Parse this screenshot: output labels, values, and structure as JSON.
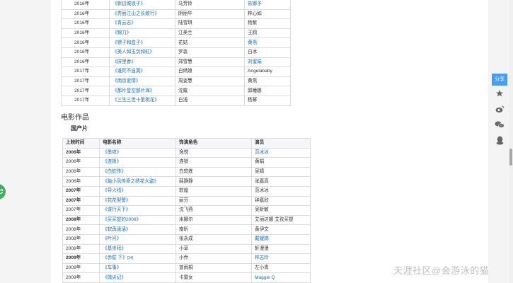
{
  "tv_rows": [
    {
      "year": "2016年",
      "title": "《新边城浪子》",
      "role": "马芳铃",
      "actor": "依娜予",
      "actor_link": true
    },
    {
      "year": "2016年",
      "title": "《秀丽江山之长歌行》",
      "role": "阴丽华",
      "actor": "林心如",
      "actor_link": false
    },
    {
      "year": "2016年",
      "title": "《青云志》",
      "role": "陆雪琪",
      "actor": "杨紫",
      "actor_link": false
    },
    {
      "year": "2016年",
      "title": "《锦刀》",
      "role": "江美兰",
      "actor": "王鸥",
      "actor_link": false
    },
    {
      "year": "2016年",
      "title": "《镖子和盒子》",
      "role": "花姑",
      "actor": "黄燕",
      "actor_link": true
    },
    {
      "year": "2016年",
      "title": "《美人如玉剑如虹》",
      "role": "罗衾",
      "actor": "白冰",
      "actor_link": false
    },
    {
      "year": "2016年",
      "title": "《屏里香》",
      "role": "郑雪慧",
      "actor": "刘蜜娟",
      "actor_link": true
    },
    {
      "year": "2017年",
      "title": "《谁死不自寞》",
      "role": "白绣娘",
      "actor": "Angelababy",
      "actor_link": false
    },
    {
      "year": "2017年",
      "title": "《南京爱情》",
      "role": "周姿慧",
      "actor": "黄燕",
      "actor_link": false
    },
    {
      "year": "2017年",
      "title": "《那片星空那片海》",
      "role": "沈蝶",
      "actor": "郭瞳娜",
      "actor_link": false
    },
    {
      "year": "2017年",
      "title": "《三生三世十里桃花》",
      "role": "白浅",
      "actor": "杨幂",
      "actor_link": false
    }
  ],
  "section_title": "电影作品",
  "sub_title": "国产片",
  "film_headers": [
    "上映时间",
    "电影名称",
    "饰演角色",
    "演员"
  ],
  "film_rows": [
    {
      "year": "2006年",
      "bold": true,
      "title": "《墨攻》",
      "sup": "",
      "role": "逸悦",
      "actor": "范冰冰",
      "actor_link": true
    },
    {
      "year": "2006年",
      "bold": false,
      "title": "《连锁》",
      "sup": "",
      "role": "连锁",
      "actor": "黄娟",
      "actor_link": false
    },
    {
      "year": "2006年",
      "bold": false,
      "title": "《白蛇传》",
      "sup": "",
      "role": "白软炼",
      "actor": "吴婧",
      "actor_link": false
    },
    {
      "year": "2006年",
      "bold": false,
      "title": "《独小凤传奇之绣花大盗》",
      "sup": "",
      "role": "薛静静",
      "actor": "张嘉高",
      "actor_link": false
    },
    {
      "year": "2007年",
      "bold": true,
      "title": "《导火线》",
      "sup": "",
      "role": "软煌",
      "actor": "范冰冰",
      "actor_link": false
    },
    {
      "year": "2007年",
      "bold": true,
      "title": "《花花型警》",
      "sup": "",
      "role": "丽芬",
      "actor": "钟嘉欣",
      "actor_link": false
    },
    {
      "year": "2007年",
      "bold": false,
      "title": "《谍行天下》",
      "sup": "",
      "role": "沈飞燕",
      "actor": "吴昕敏",
      "actor_link": false
    },
    {
      "year": "2008年",
      "bold": true,
      "title": "《买买提的2008》",
      "sup": "",
      "role": "米娜尔",
      "actor": "艾丽达娜 艾孜买提",
      "actor_link": false
    },
    {
      "year": "2008年",
      "bold": false,
      "title": "《软苒唐话》",
      "sup": "",
      "role": "南昕",
      "actor": "黄伊文",
      "actor_link": false
    },
    {
      "year": "2008年",
      "bold": false,
      "title": "《叶问》",
      "sup": "",
      "role": "张永成",
      "actor": "戴嫒娣",
      "actor_link": true
    },
    {
      "year": "2008年",
      "bold": false,
      "title": "《基崇拜》",
      "sup": "",
      "role": "小草",
      "actor": "轩漫漫",
      "actor_link": false
    },
    {
      "year": "2009年",
      "bold": true,
      "title": "《赤壁 下》",
      "sup": "[34]",
      "role": "小乔",
      "actor": "林志玲",
      "actor_link": true
    },
    {
      "year": "2009年",
      "bold": false,
      "title": "《车事》",
      "sup": "",
      "role": "曾雨桐",
      "actor": "左小青",
      "actor_link": false
    },
    {
      "year": "2009年",
      "bold": false,
      "title": "《微尖记》",
      "sup": "",
      "role": "卡雷女",
      "actor": "Maggie Q",
      "actor_link": true
    }
  ],
  "share_label": "分享",
  "watermark": "天涯社区@会游泳的猫",
  "colors": {
    "link": "#136ec2",
    "share": "#459df5",
    "left_tab": "#3fae5e"
  }
}
